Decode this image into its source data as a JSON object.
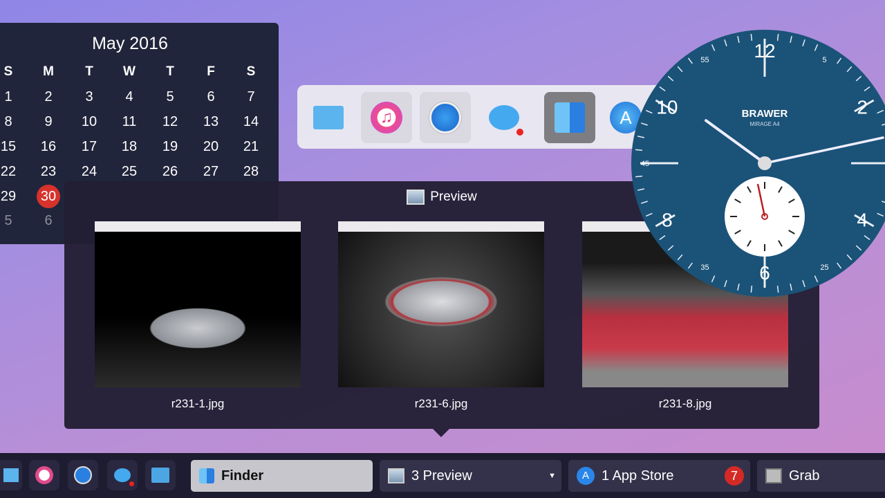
{
  "calendar": {
    "title": "May 2016",
    "weekdays": [
      "S",
      "M",
      "T",
      "W",
      "T",
      "F",
      "S"
    ],
    "weeks": [
      [
        "1",
        "2",
        "3",
        "4",
        "5",
        "6",
        "7"
      ],
      [
        "8",
        "9",
        "10",
        "11",
        "12",
        "13",
        "14"
      ],
      [
        "15",
        "16",
        "17",
        "18",
        "19",
        "20",
        "21"
      ],
      [
        "22",
        "23",
        "24",
        "25",
        "26",
        "27",
        "28"
      ],
      [
        "29",
        "30"
      ],
      [
        "5",
        "6"
      ]
    ],
    "today": "30"
  },
  "dock": {
    "items": [
      "folder",
      "itunes",
      "safari",
      "messages",
      "finder",
      "app-store"
    ]
  },
  "preview": {
    "title": "Preview",
    "files": [
      "r231-1.jpg",
      "r231-6.jpg",
      "r231-8.jpg"
    ]
  },
  "clock": {
    "brand": "BRAWER",
    "model": "MIRAGE A4",
    "hour_numerals": [
      "12",
      "2",
      "4",
      "6",
      "8",
      "10"
    ],
    "minute_numerals": [
      "5",
      "25",
      "35",
      "45",
      "55"
    ],
    "time": {
      "hour": 10,
      "minute": 12,
      "second": 58
    }
  },
  "taskbar": {
    "finder": "Finder",
    "preview": "3 Preview",
    "appstore": "1 App Store",
    "appstore_badge": "7",
    "grab": "Grab"
  },
  "colors": {
    "clock_face": "#1b5278",
    "badge": "#d42a25",
    "today": "#d8322c"
  }
}
